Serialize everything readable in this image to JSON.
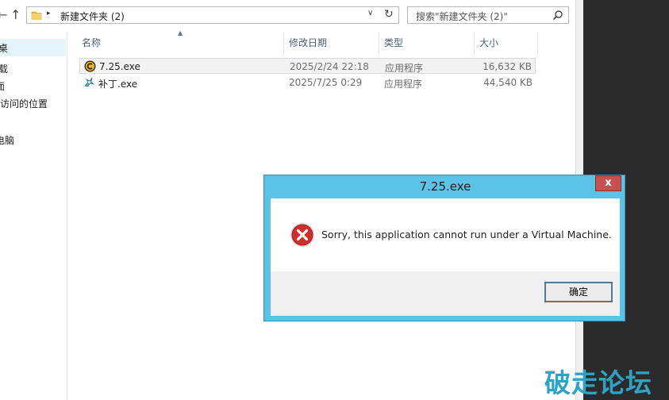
{
  "navbar": {
    "back": "←",
    "up": "↑",
    "breadcrumb_sep": "▸",
    "address": "新建文件夹 (2)",
    "dropdown": "∨",
    "refresh": "↻",
    "search_placeholder": "搜索\"新建文件夹 (2)\""
  },
  "navpane": {
    "items": [
      "桌",
      "载",
      "面",
      "访问的位置",
      "电脑"
    ]
  },
  "columns": {
    "name": "名称",
    "modified": "修改日期",
    "type": "类型",
    "size": "大小"
  },
  "sort_indicator": "▲",
  "files": [
    {
      "name": "7.25.exe",
      "modified": "2025/2/24 22:18",
      "type": "应用程序",
      "size": "16,632 KB",
      "icon": "app-c-icon"
    },
    {
      "name": "补丁.exe",
      "modified": "2025/7/25 0:29",
      "type": "应用程序",
      "size": "44,540 KB",
      "icon": "patch-icon"
    }
  ],
  "dialog": {
    "title": "7.25.exe",
    "close": "x",
    "message": "Sorry, this application cannot run under a Virtual Machine.",
    "ok_label": "确定",
    "icon": "error-icon"
  },
  "watermark": "破走论坛",
  "colors": {
    "dialog_frame": "#5bc3e8",
    "close_button": "#c75050",
    "selection": "#e5f3fb",
    "watermark": "#2fa3c5"
  }
}
